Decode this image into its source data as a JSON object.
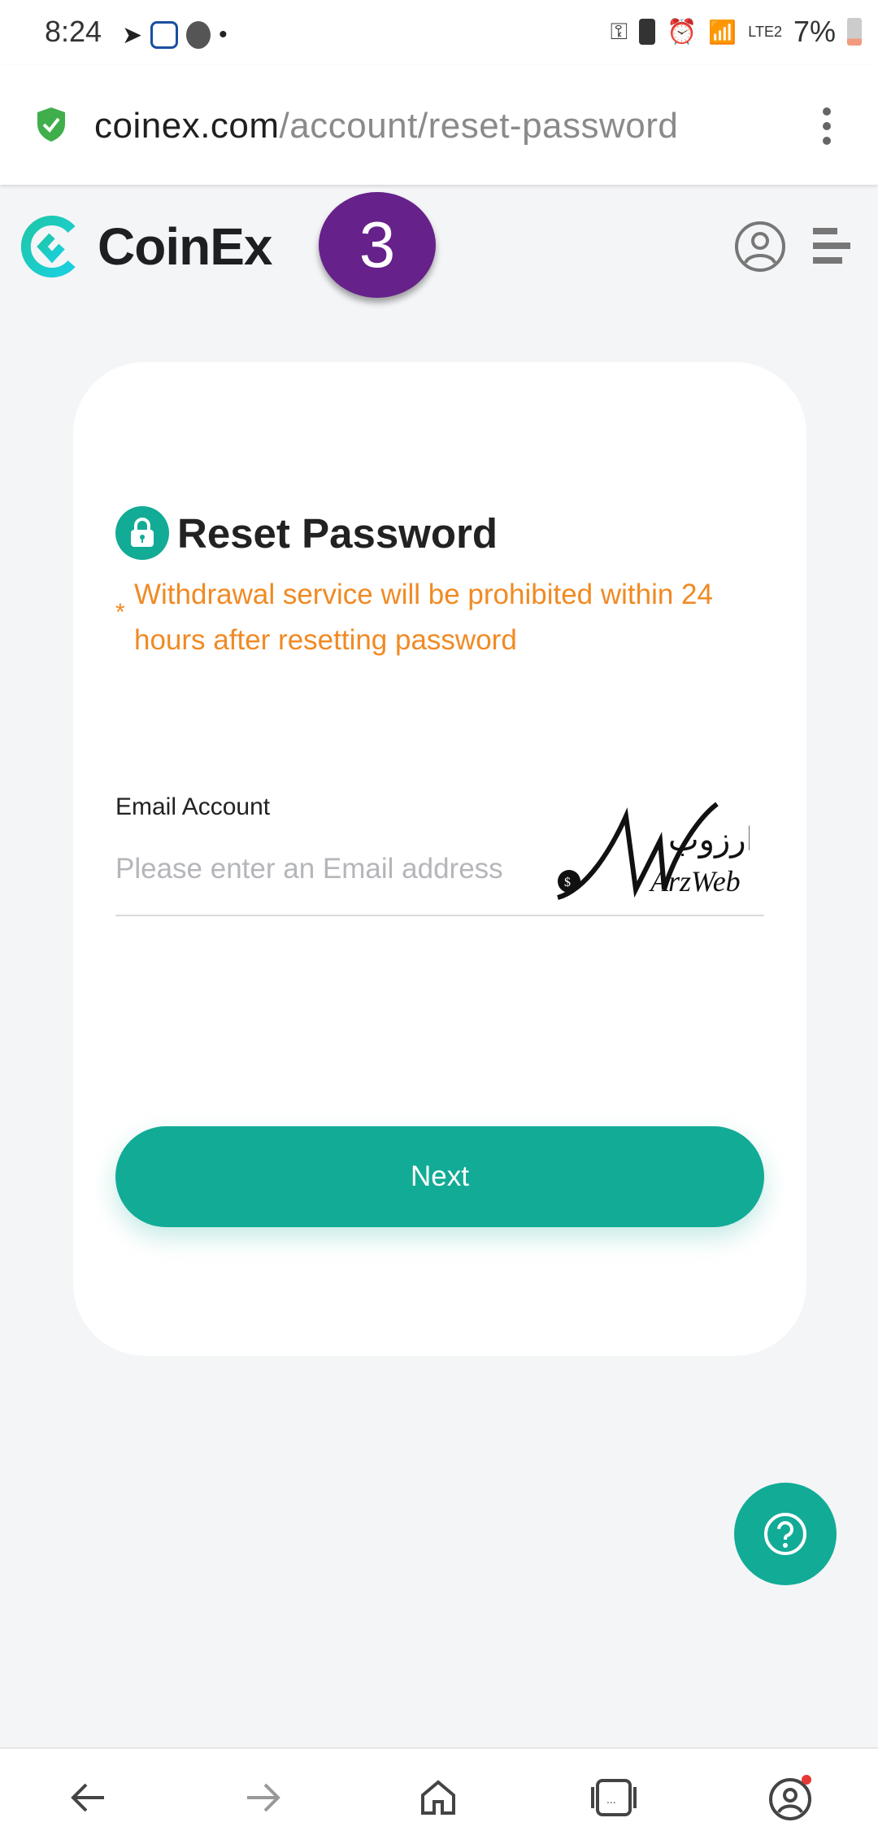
{
  "status_bar": {
    "time": "8:24",
    "battery": "7%",
    "network": "LTE2"
  },
  "browser": {
    "url_domain": "coinex.com",
    "url_path": "/account/reset-password"
  },
  "header": {
    "brand": "CoinEx",
    "step_badge": "3"
  },
  "card": {
    "title": "Reset Password",
    "warning_star": "*",
    "warning": "Withdrawal service will be prohibited within 24 hours after resetting password",
    "email_label": "Email Account",
    "email_placeholder": "Please enter an Email address",
    "email_value": "",
    "next_label": "Next"
  },
  "watermark": {
    "text_latin": "ArzWeb",
    "text_arabic": "ارزوب"
  },
  "colors": {
    "accent": "#12ab96",
    "warning": "#f08a24",
    "badge": "#66218a"
  }
}
